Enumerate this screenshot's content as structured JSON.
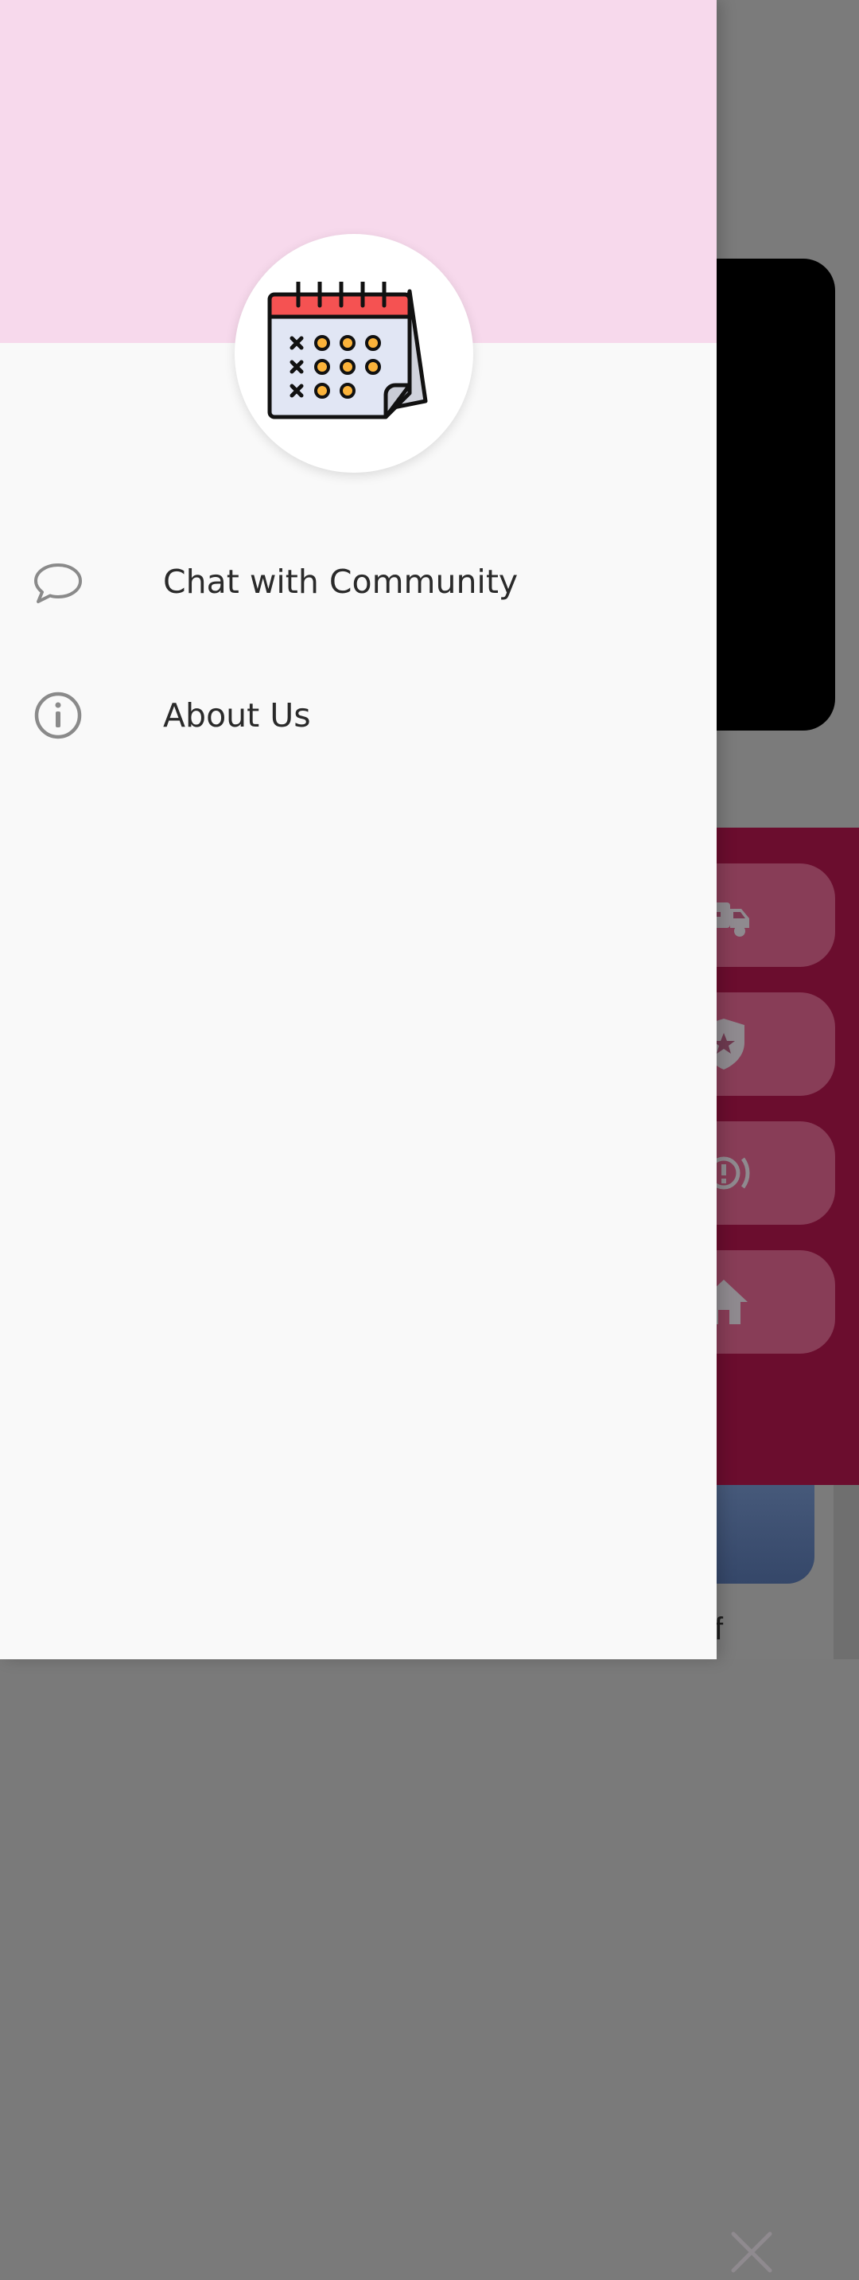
{
  "drawer": {
    "header_color": "#f7d9ec",
    "logo_icon": "calendar-icon",
    "menu": [
      {
        "icon": "chat-bubble-icon",
        "label": "Chat with Community"
      },
      {
        "icon": "info-icon",
        "label": "About Us"
      }
    ]
  },
  "background": {
    "panel_color": "#6b0d2e",
    "tiles": [
      {
        "icon": "ambulance-icon"
      },
      {
        "icon": "police-badge-icon"
      },
      {
        "icon": "alert-icon"
      },
      {
        "icon": "home-icon"
      }
    ],
    "close_icon": "close-icon",
    "partial_text": "f"
  }
}
